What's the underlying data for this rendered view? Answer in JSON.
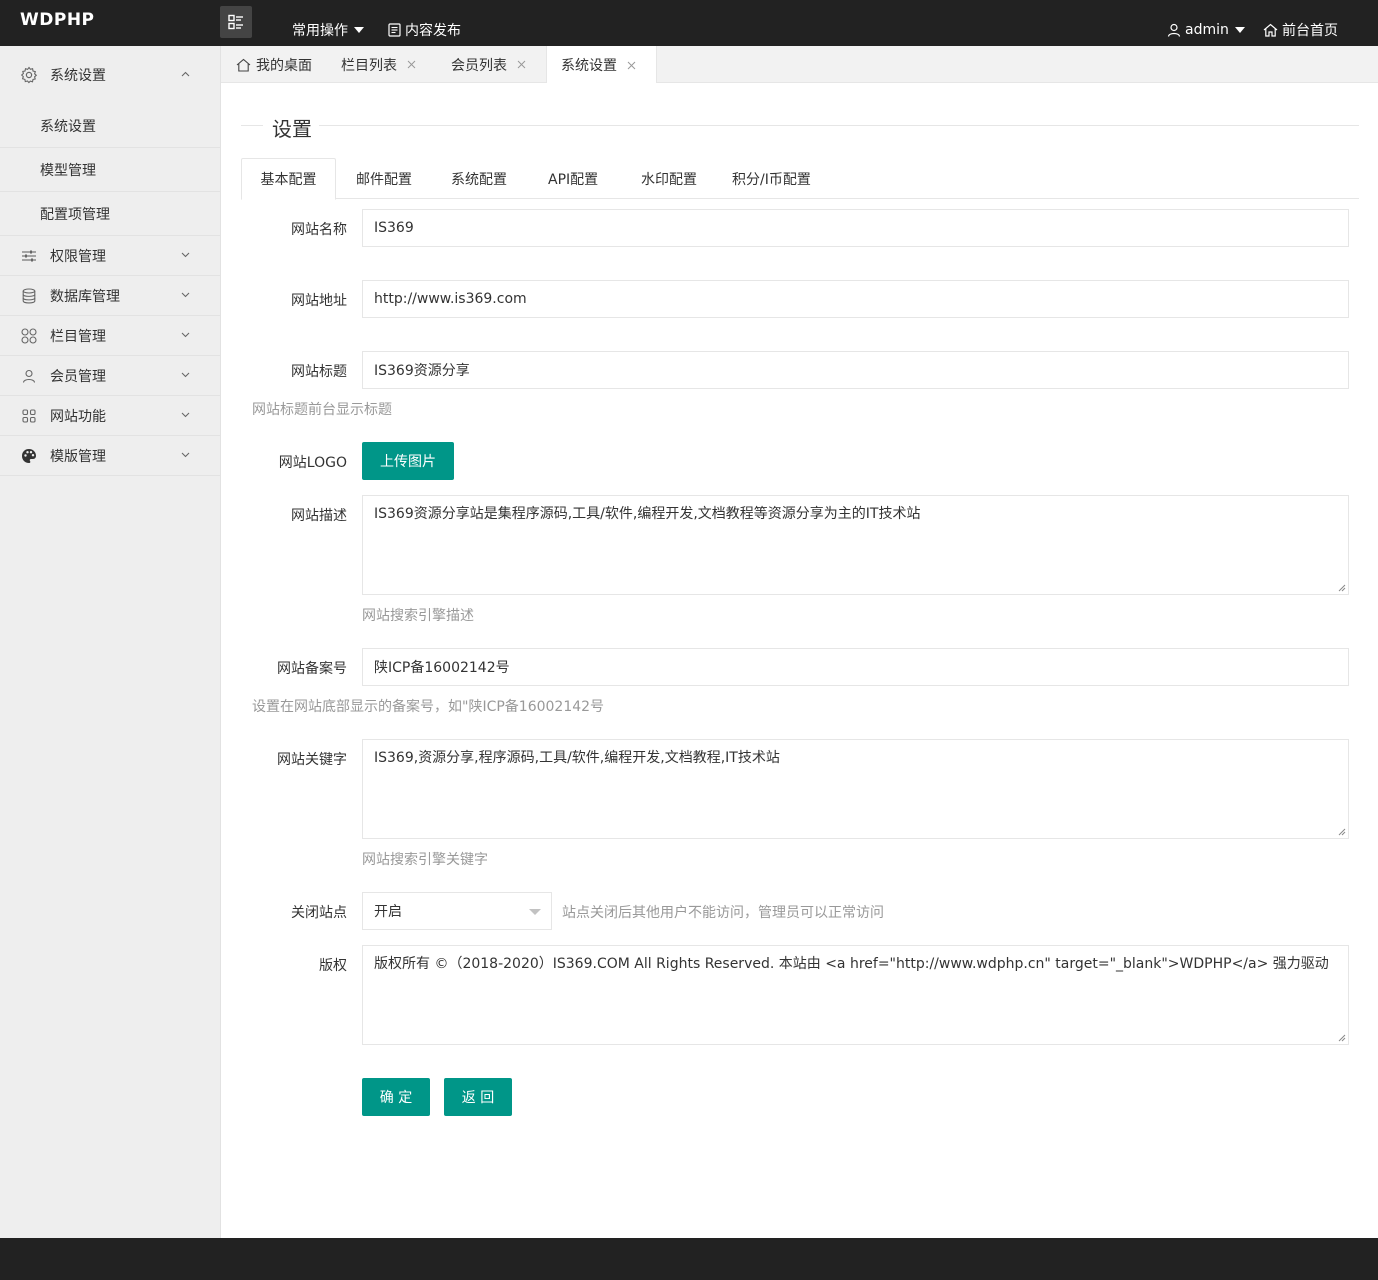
{
  "header": {
    "logo": "WDPHP",
    "common_ops": "常用操作",
    "content_publish": "内容发布",
    "user": "admin",
    "front_home": "前台首页"
  },
  "sidebar": {
    "groups": [
      {
        "label": "系统设置",
        "icon": "gear-icon",
        "expanded": true,
        "items": [
          "系统设置",
          "模型管理",
          "配置项管理"
        ]
      },
      {
        "label": "权限管理",
        "icon": "sliders-icon"
      },
      {
        "label": "数据库管理",
        "icon": "database-icon"
      },
      {
        "label": "栏目管理",
        "icon": "grid-icon"
      },
      {
        "label": "会员管理",
        "icon": "user-icon"
      },
      {
        "label": "网站功能",
        "icon": "apps-icon"
      },
      {
        "label": "模版管理",
        "icon": "palette-icon"
      }
    ]
  },
  "page_tabs": [
    {
      "label": "我的桌面",
      "icon": "home-icon"
    },
    {
      "label": "栏目列表",
      "closable": true
    },
    {
      "label": "会员列表",
      "closable": true
    },
    {
      "label": "系统设置",
      "closable": true,
      "active": true
    }
  ],
  "section": {
    "title": "设置"
  },
  "config_tabs": [
    "基本配置",
    "邮件配置",
    "系统配置",
    "API配置",
    "水印配置",
    "积分/I币配置"
  ],
  "form": {
    "site_name": {
      "label": "网站名称",
      "value": "IS369"
    },
    "site_url": {
      "label": "网站地址",
      "value": "http://www.is369.com"
    },
    "site_title": {
      "label": "网站标题",
      "value": "IS369资源分享",
      "help": "网站标题前台显示标题"
    },
    "site_logo": {
      "label": "网站LOGO",
      "button": "上传图片"
    },
    "site_desc": {
      "label": "网站描述",
      "value": "IS369资源分享站是集程序源码,工具/软件,编程开发,文档教程等资源分享为主的IT技术站",
      "help": "网站搜索引擎描述"
    },
    "site_icp": {
      "label": "网站备案号",
      "value": "陕ICP备16002142号",
      "help": "设置在网站底部显示的备案号，如\"陕ICP备16002142号"
    },
    "site_keywords": {
      "label": "网站关键字",
      "value": "IS369,资源分享,程序源码,工具/软件,编程开发,文档教程,IT技术站",
      "help": "网站搜索引擎关键字"
    },
    "site_close": {
      "label": "关闭站点",
      "value": "开启",
      "help": "站点关闭后其他用户不能访问，管理员可以正常访问"
    },
    "copyright": {
      "label": "版权",
      "value": "版权所有 ©（2018-2020）IS369.COM All Rights Reserved. 本站由 <a href=\"http://www.wdphp.cn\" target=\"_blank\">WDPHP</a> 强力驱动"
    },
    "submit": "确 定",
    "back": "返 回"
  },
  "colors": {
    "primary": "#009688",
    "header_bg": "#222222",
    "sidebar_bg": "#eeeeee"
  }
}
